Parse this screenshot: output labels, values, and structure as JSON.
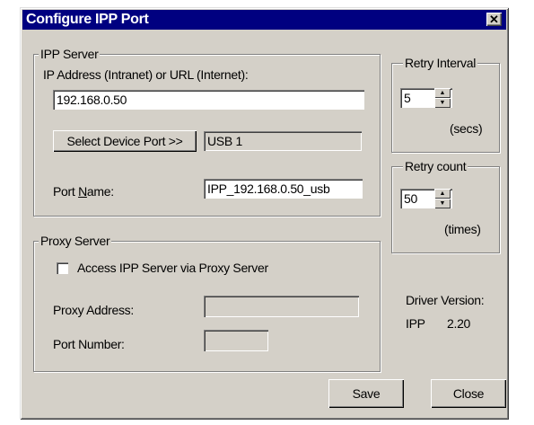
{
  "window": {
    "title": "Configure IPP Port"
  },
  "ipp_server": {
    "legend": "IPP Server",
    "address_label": "IP Address (Intranet) or URL (Internet):",
    "address_value": "192.168.0.50",
    "select_port_label": "Select Device Port >>",
    "device_port_value": "USB 1",
    "port_name_label_pre": "Port ",
    "port_name_label_u": "N",
    "port_name_label_post": "ame:",
    "port_name_value": "IPP_192.168.0.50_usb"
  },
  "retry_interval": {
    "legend": "Retry Interval",
    "value": "5",
    "unit": "(secs)"
  },
  "retry_count": {
    "legend": "Retry count",
    "value": "50",
    "unit": "(times)"
  },
  "proxy_server": {
    "legend": "Proxy Server",
    "checkbox_label": "Access IPP Server via Proxy Server",
    "checked": false,
    "address_label": "Proxy Address:",
    "address_value": "",
    "port_label": "Port Number:",
    "port_value": ""
  },
  "driver_version": {
    "label": "Driver Version:",
    "name": "IPP",
    "version": "2.20"
  },
  "buttons": {
    "save": "Save",
    "close": "Close"
  }
}
